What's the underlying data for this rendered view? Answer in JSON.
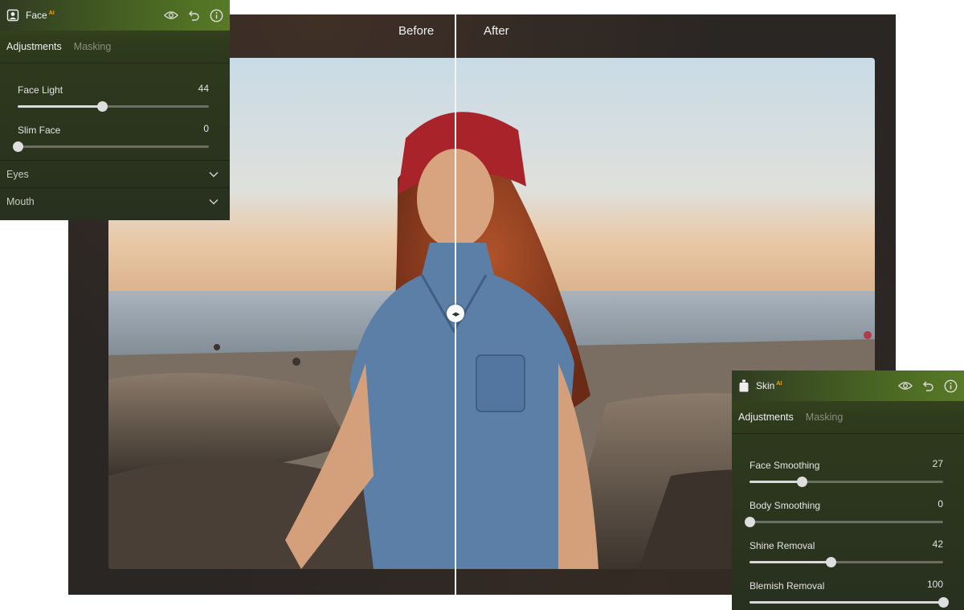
{
  "compare": {
    "before_label": "Before",
    "after_label": "After"
  },
  "face_panel": {
    "title": "Face",
    "ai_badge": "AI",
    "icons": [
      "face-portrait-icon",
      "eye-icon",
      "undo-icon",
      "info-icon"
    ],
    "tabs": [
      {
        "label": "Adjustments",
        "active": true
      },
      {
        "label": "Masking",
        "active": false
      }
    ],
    "sliders": [
      {
        "label": "Face Light",
        "value": "44",
        "fraction": 0.44
      },
      {
        "label": "Slim Face",
        "value": "0",
        "fraction": 0.0
      }
    ],
    "sections": [
      {
        "label": "Eyes"
      },
      {
        "label": "Mouth"
      }
    ]
  },
  "skin_panel": {
    "title": "Skin",
    "ai_badge": "AI",
    "icons": [
      "lotion-bottle-icon",
      "eye-icon",
      "undo-icon",
      "info-icon"
    ],
    "tabs": [
      {
        "label": "Adjustments",
        "active": true
      },
      {
        "label": "Masking",
        "active": false
      }
    ],
    "sliders": [
      {
        "label": "Face Smoothing",
        "value": "27",
        "fraction": 0.27
      },
      {
        "label": "Body Smoothing",
        "value": "0",
        "fraction": 0.0
      },
      {
        "label": "Shine Removal",
        "value": "42",
        "fraction": 0.42
      },
      {
        "label": "Blemish Removal",
        "value": "100",
        "fraction": 1.0
      }
    ]
  },
  "colors": {
    "panel_bg": "#28301f",
    "header_green": "#587a26",
    "ai_badge": "#f0a020",
    "slider_track": "#6b6e60",
    "slider_fill": "#d9d9d9"
  }
}
